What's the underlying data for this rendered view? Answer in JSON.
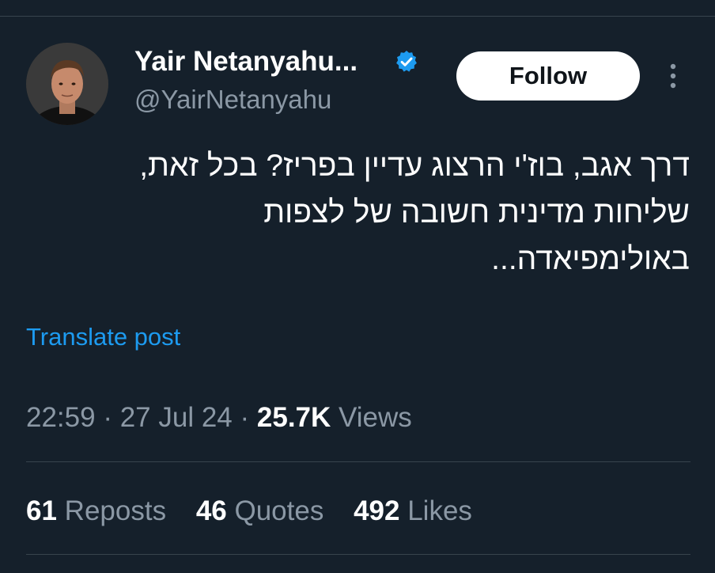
{
  "author": {
    "display_name": "Yair Netanyahu...",
    "handle": "@YairNetanyahu",
    "verified": true
  },
  "actions": {
    "follow_label": "Follow",
    "more_icon": "more-vertical-icon"
  },
  "tweet": {
    "text": "דרך אגב, בוז'י הרצוג עדיין בפריז? בכל זאת, שליחות מדינית חשובה של לצפות באולימפיאדה...",
    "translate_label": "Translate post"
  },
  "meta": {
    "time": "22:59",
    "separator_1": "·",
    "date": "27 Jul 24",
    "separator_2": "·",
    "views_count": "25.7K",
    "views_label": "Views"
  },
  "stats": {
    "reposts_count": "61",
    "reposts_label": "Reposts",
    "quotes_count": "46",
    "quotes_label": "Quotes",
    "likes_count": "492",
    "likes_label": "Likes"
  },
  "colors": {
    "background": "#15202b",
    "accent": "#1d9bf0",
    "muted": "#8b98a5",
    "divider": "#38444d"
  }
}
